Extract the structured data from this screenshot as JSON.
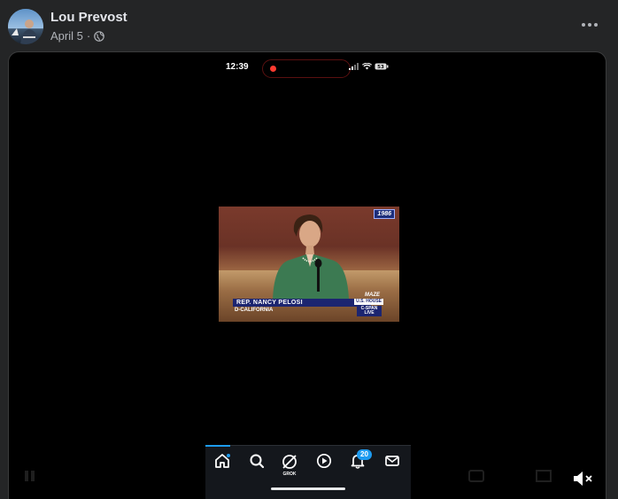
{
  "post": {
    "author": "Lou Prevost",
    "date": "April 5",
    "date_separator": "·",
    "privacy_icon": "globe-icon",
    "more_icon": "more-options-icon"
  },
  "phone": {
    "time": "12:39",
    "battery": "53"
  },
  "broadcast": {
    "year": "1986",
    "name": "REP. NANCY PELOSI",
    "district": "D-CALIFORNIA",
    "maze": "MAZE",
    "house": "U.S. HOUSE",
    "network": "C-SPAN",
    "live": "LIVE"
  },
  "tabbar": {
    "tabs": [
      {
        "icon": "home-icon",
        "label": ""
      },
      {
        "icon": "search-icon",
        "label": ""
      },
      {
        "icon": "grok-icon",
        "label": "GROK"
      },
      {
        "icon": "play-icon",
        "label": ""
      },
      {
        "icon": "bell-icon",
        "label": ""
      },
      {
        "icon": "mail-icon",
        "label": ""
      }
    ],
    "notification_count": "20"
  },
  "video": {
    "mute_icon": "muted-speaker-icon"
  },
  "colors": {
    "background": "#242526",
    "accent": "#1d9bf0",
    "recording": "#ff3b30"
  }
}
